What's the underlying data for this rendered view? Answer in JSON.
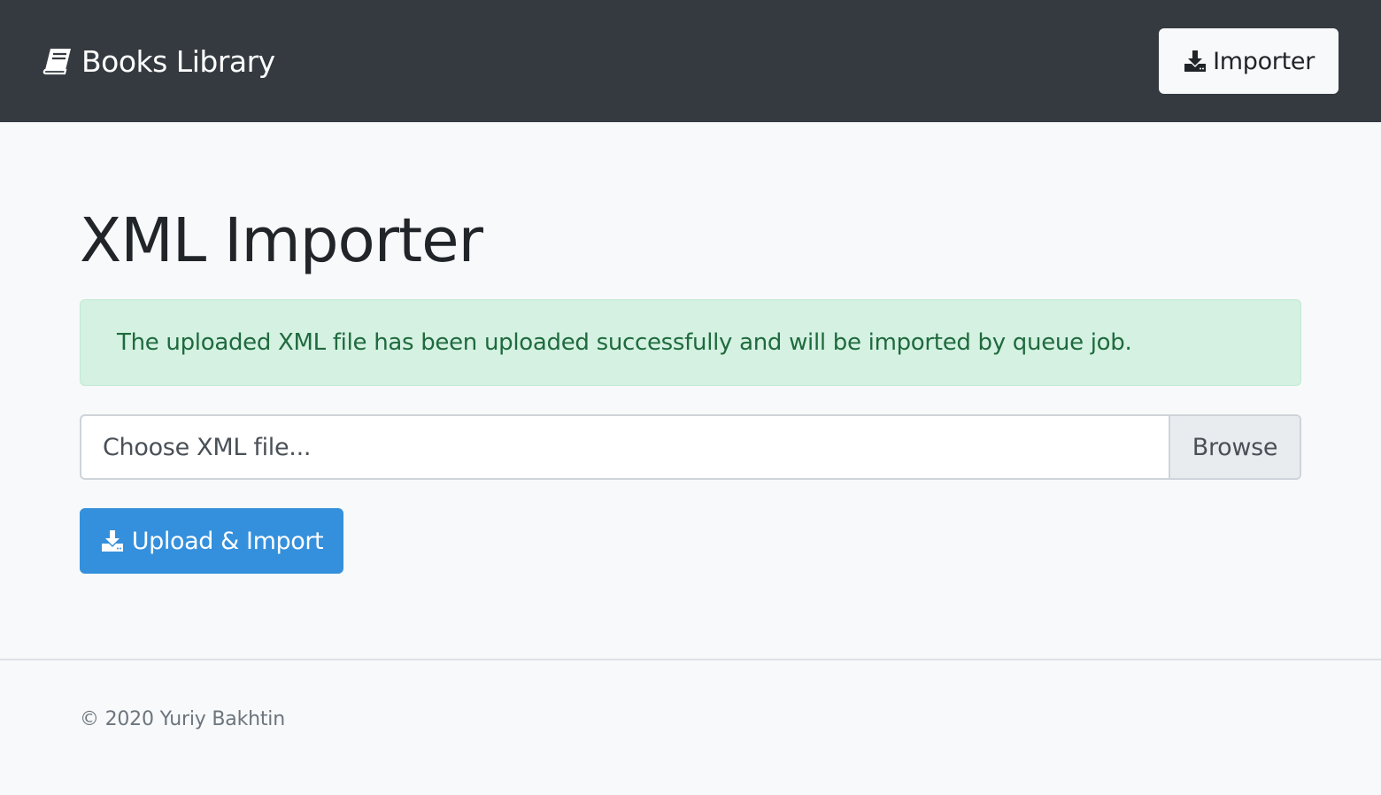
{
  "navbar": {
    "brand": "Books Library",
    "brand_icon": "book-icon",
    "importer_button": "Importer",
    "importer_icon": "download-icon",
    "background": "#343a40"
  },
  "main": {
    "title": "XML Importer",
    "alert": {
      "message": "The uploaded XML file has been uploaded successfully and will be imported by queue job.",
      "type": "success",
      "background": "#d4f1e2",
      "color": "#1f6a3d"
    },
    "file_input": {
      "placeholder": "Choose XML file...",
      "browse_label": "Browse"
    },
    "submit": {
      "label": "Upload & Import",
      "icon": "download-icon",
      "color": "#3490dc"
    }
  },
  "footer": {
    "copyright": "© 2020 Yuriy Bakhtin"
  }
}
